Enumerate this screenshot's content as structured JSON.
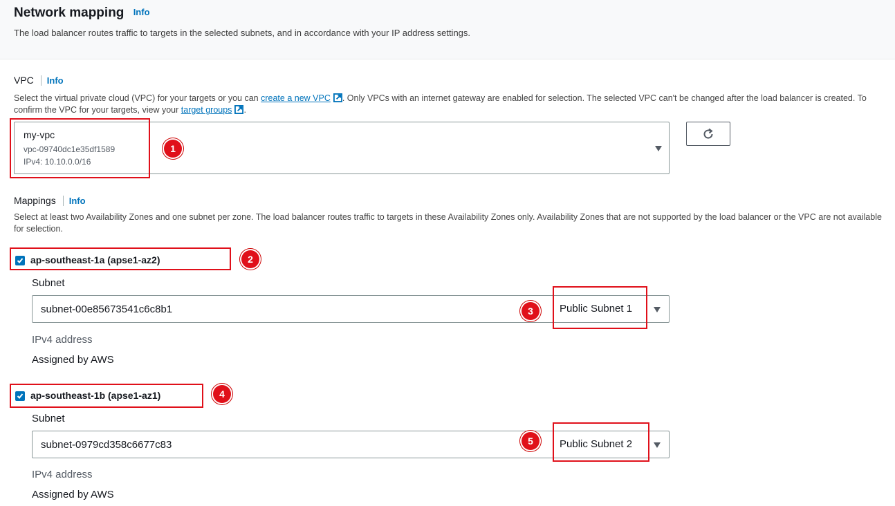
{
  "header": {
    "title": "Network mapping",
    "info": "Info",
    "description": "The load balancer routes traffic to targets in the selected subnets, and in accordance with your IP address settings."
  },
  "vpc": {
    "label": "VPC",
    "info": "Info",
    "desc_part1": "Select the virtual private cloud (VPC) for your targets or you can ",
    "create_link": "create a new VPC",
    "desc_part2": ". Only VPCs with an internet gateway are enabled for selection. The selected VPC can't be changed after the load balancer is created. To confirm the VPC for your targets, view your ",
    "target_link": "target groups",
    "desc_part3": ".",
    "selected_name": "my-vpc",
    "selected_id": "vpc-09740dc1e35df1589",
    "selected_cidr": "IPv4: 10.10.0.0/16"
  },
  "mappings": {
    "label": "Mappings",
    "info": "Info",
    "description": "Select at least two Availability Zones and one subnet per zone. The load balancer routes traffic to targets in these Availability Zones only. Availability Zones that are not supported by the load balancer or the VPC are not available for selection.",
    "zones": [
      {
        "name": "ap-southeast-1a (apse1-az2)",
        "subnet_label": "Subnet",
        "subnet_id": "subnet-00e85673541c6c8b1",
        "subnet_name": "Public Subnet 1",
        "ip_label": "IPv4 address",
        "ip_value": "Assigned by AWS"
      },
      {
        "name": "ap-southeast-1b (apse1-az1)",
        "subnet_label": "Subnet",
        "subnet_id": "subnet-0979cd358c6677c83",
        "subnet_name": "Public Subnet 2",
        "ip_label": "IPv4 address",
        "ip_value": "Assigned by AWS"
      }
    ]
  },
  "annotations": [
    "1",
    "2",
    "3",
    "4",
    "5"
  ],
  "colors": {
    "link": "#0073bb",
    "annotation": "#e0101a",
    "checkbox": "#0073bb"
  }
}
